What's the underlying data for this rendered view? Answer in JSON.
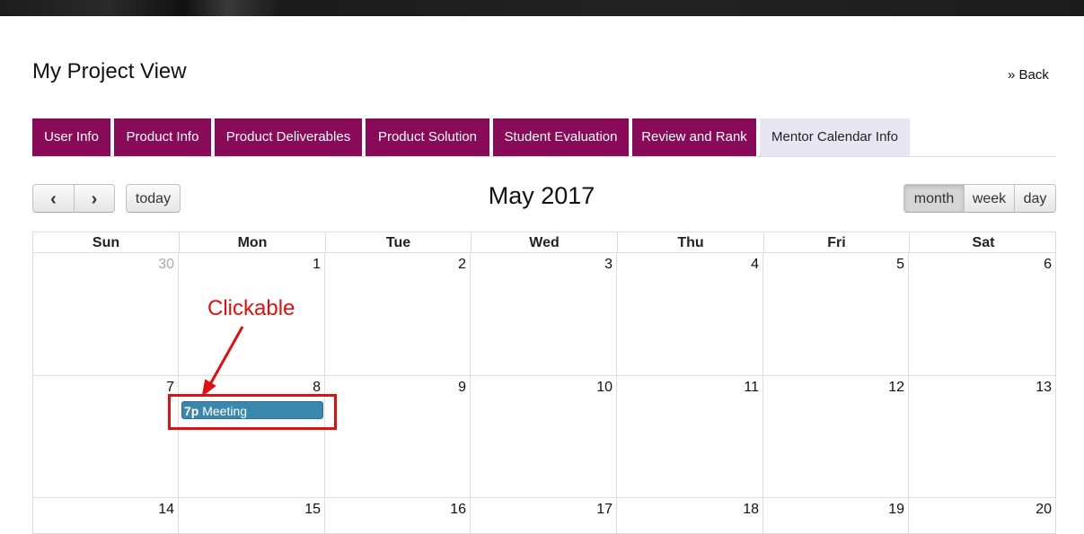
{
  "page": {
    "title": "My Project View",
    "back_label": "» Back"
  },
  "tabs": [
    {
      "label": "User Info",
      "active": false
    },
    {
      "label": "Product Info",
      "active": false
    },
    {
      "label": "Product Deliverables",
      "active": false
    },
    {
      "label": "Product Solution",
      "active": false
    },
    {
      "label": "Student Evaluation",
      "active": false
    },
    {
      "label": "Review and Rank",
      "active": false
    },
    {
      "label": "Mentor Calendar Info",
      "active": true
    }
  ],
  "toolbar": {
    "prev_icon": "‹",
    "next_icon": "›",
    "today_label": "today",
    "title": "May 2017",
    "views": [
      {
        "label": "month",
        "active": true
      },
      {
        "label": "week",
        "active": false
      },
      {
        "label": "day",
        "active": false
      }
    ]
  },
  "calendar": {
    "weekdays": [
      "Sun",
      "Mon",
      "Tue",
      "Wed",
      "Thu",
      "Fri",
      "Sat"
    ],
    "weeks": [
      [
        {
          "day": "30",
          "other": true
        },
        {
          "day": "1"
        },
        {
          "day": "2"
        },
        {
          "day": "3"
        },
        {
          "day": "4"
        },
        {
          "day": "5"
        },
        {
          "day": "6"
        }
      ],
      [
        {
          "day": "7"
        },
        {
          "day": "8"
        },
        {
          "day": "9"
        },
        {
          "day": "10"
        },
        {
          "day": "11"
        },
        {
          "day": "12"
        },
        {
          "day": "13"
        }
      ],
      [
        {
          "day": "14"
        },
        {
          "day": "15"
        },
        {
          "day": "16"
        },
        {
          "day": "17"
        },
        {
          "day": "18"
        },
        {
          "day": "19"
        },
        {
          "day": "20"
        }
      ]
    ],
    "events": [
      {
        "time": "7p",
        "title": "Meeting"
      }
    ]
  },
  "annotation": {
    "label": "Clickable",
    "color": "#e01010"
  },
  "colors": {
    "tab_bg": "#8a0a5a",
    "tab_active_bg": "#e8e6f2",
    "event_bg": "#3a87ad"
  }
}
